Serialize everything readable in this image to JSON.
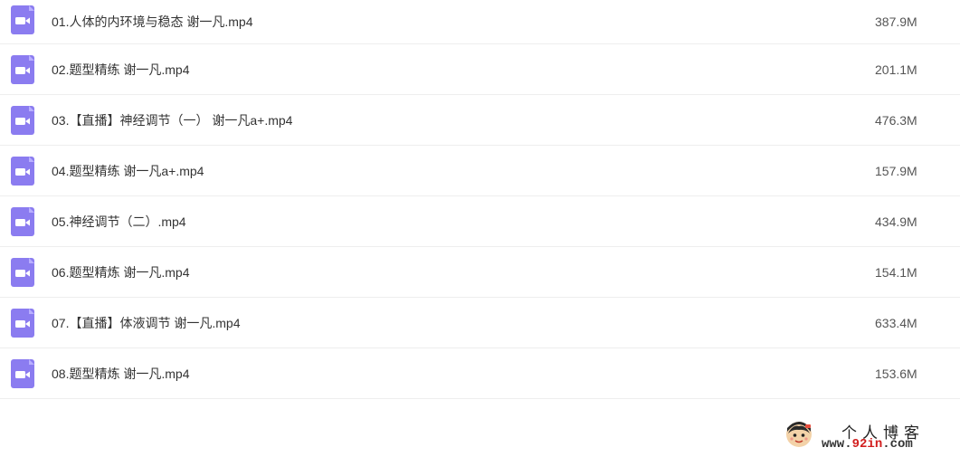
{
  "files": [
    {
      "name": "01.人体的内环境与稳态 谢一凡.mp4",
      "size": "387.9M",
      "icon": "video-file-icon"
    },
    {
      "name": "02.题型精练 谢一凡.mp4",
      "size": "201.1M",
      "icon": "video-file-icon"
    },
    {
      "name": "03.【直播】神经调节（一） 谢一凡a+.mp4",
      "size": "476.3M",
      "icon": "video-file-icon"
    },
    {
      "name": "04.题型精练 谢一凡a+.mp4",
      "size": "157.9M",
      "icon": "video-file-icon"
    },
    {
      "name": "05.神经调节（二）.mp4",
      "size": "434.9M",
      "icon": "video-file-icon"
    },
    {
      "name": "06.题型精炼 谢一凡.mp4",
      "size": "154.1M",
      "icon": "video-file-icon"
    },
    {
      "name": "07.【直播】体液调节 谢一凡.mp4",
      "size": "633.4M",
      "icon": "video-file-icon"
    },
    {
      "name": "08.题型精炼 谢一凡.mp4",
      "size": "153.6M",
      "icon": "video-file-icon"
    }
  ],
  "watermark": {
    "title": "个人博客",
    "url_prefix": "www.",
    "url_accent": "92in",
    "url_suffix": ".com"
  },
  "colors": {
    "icon_bg": "#8b7cf0",
    "divider": "#eeeeee",
    "watermark_accent": "#d21e1e"
  }
}
